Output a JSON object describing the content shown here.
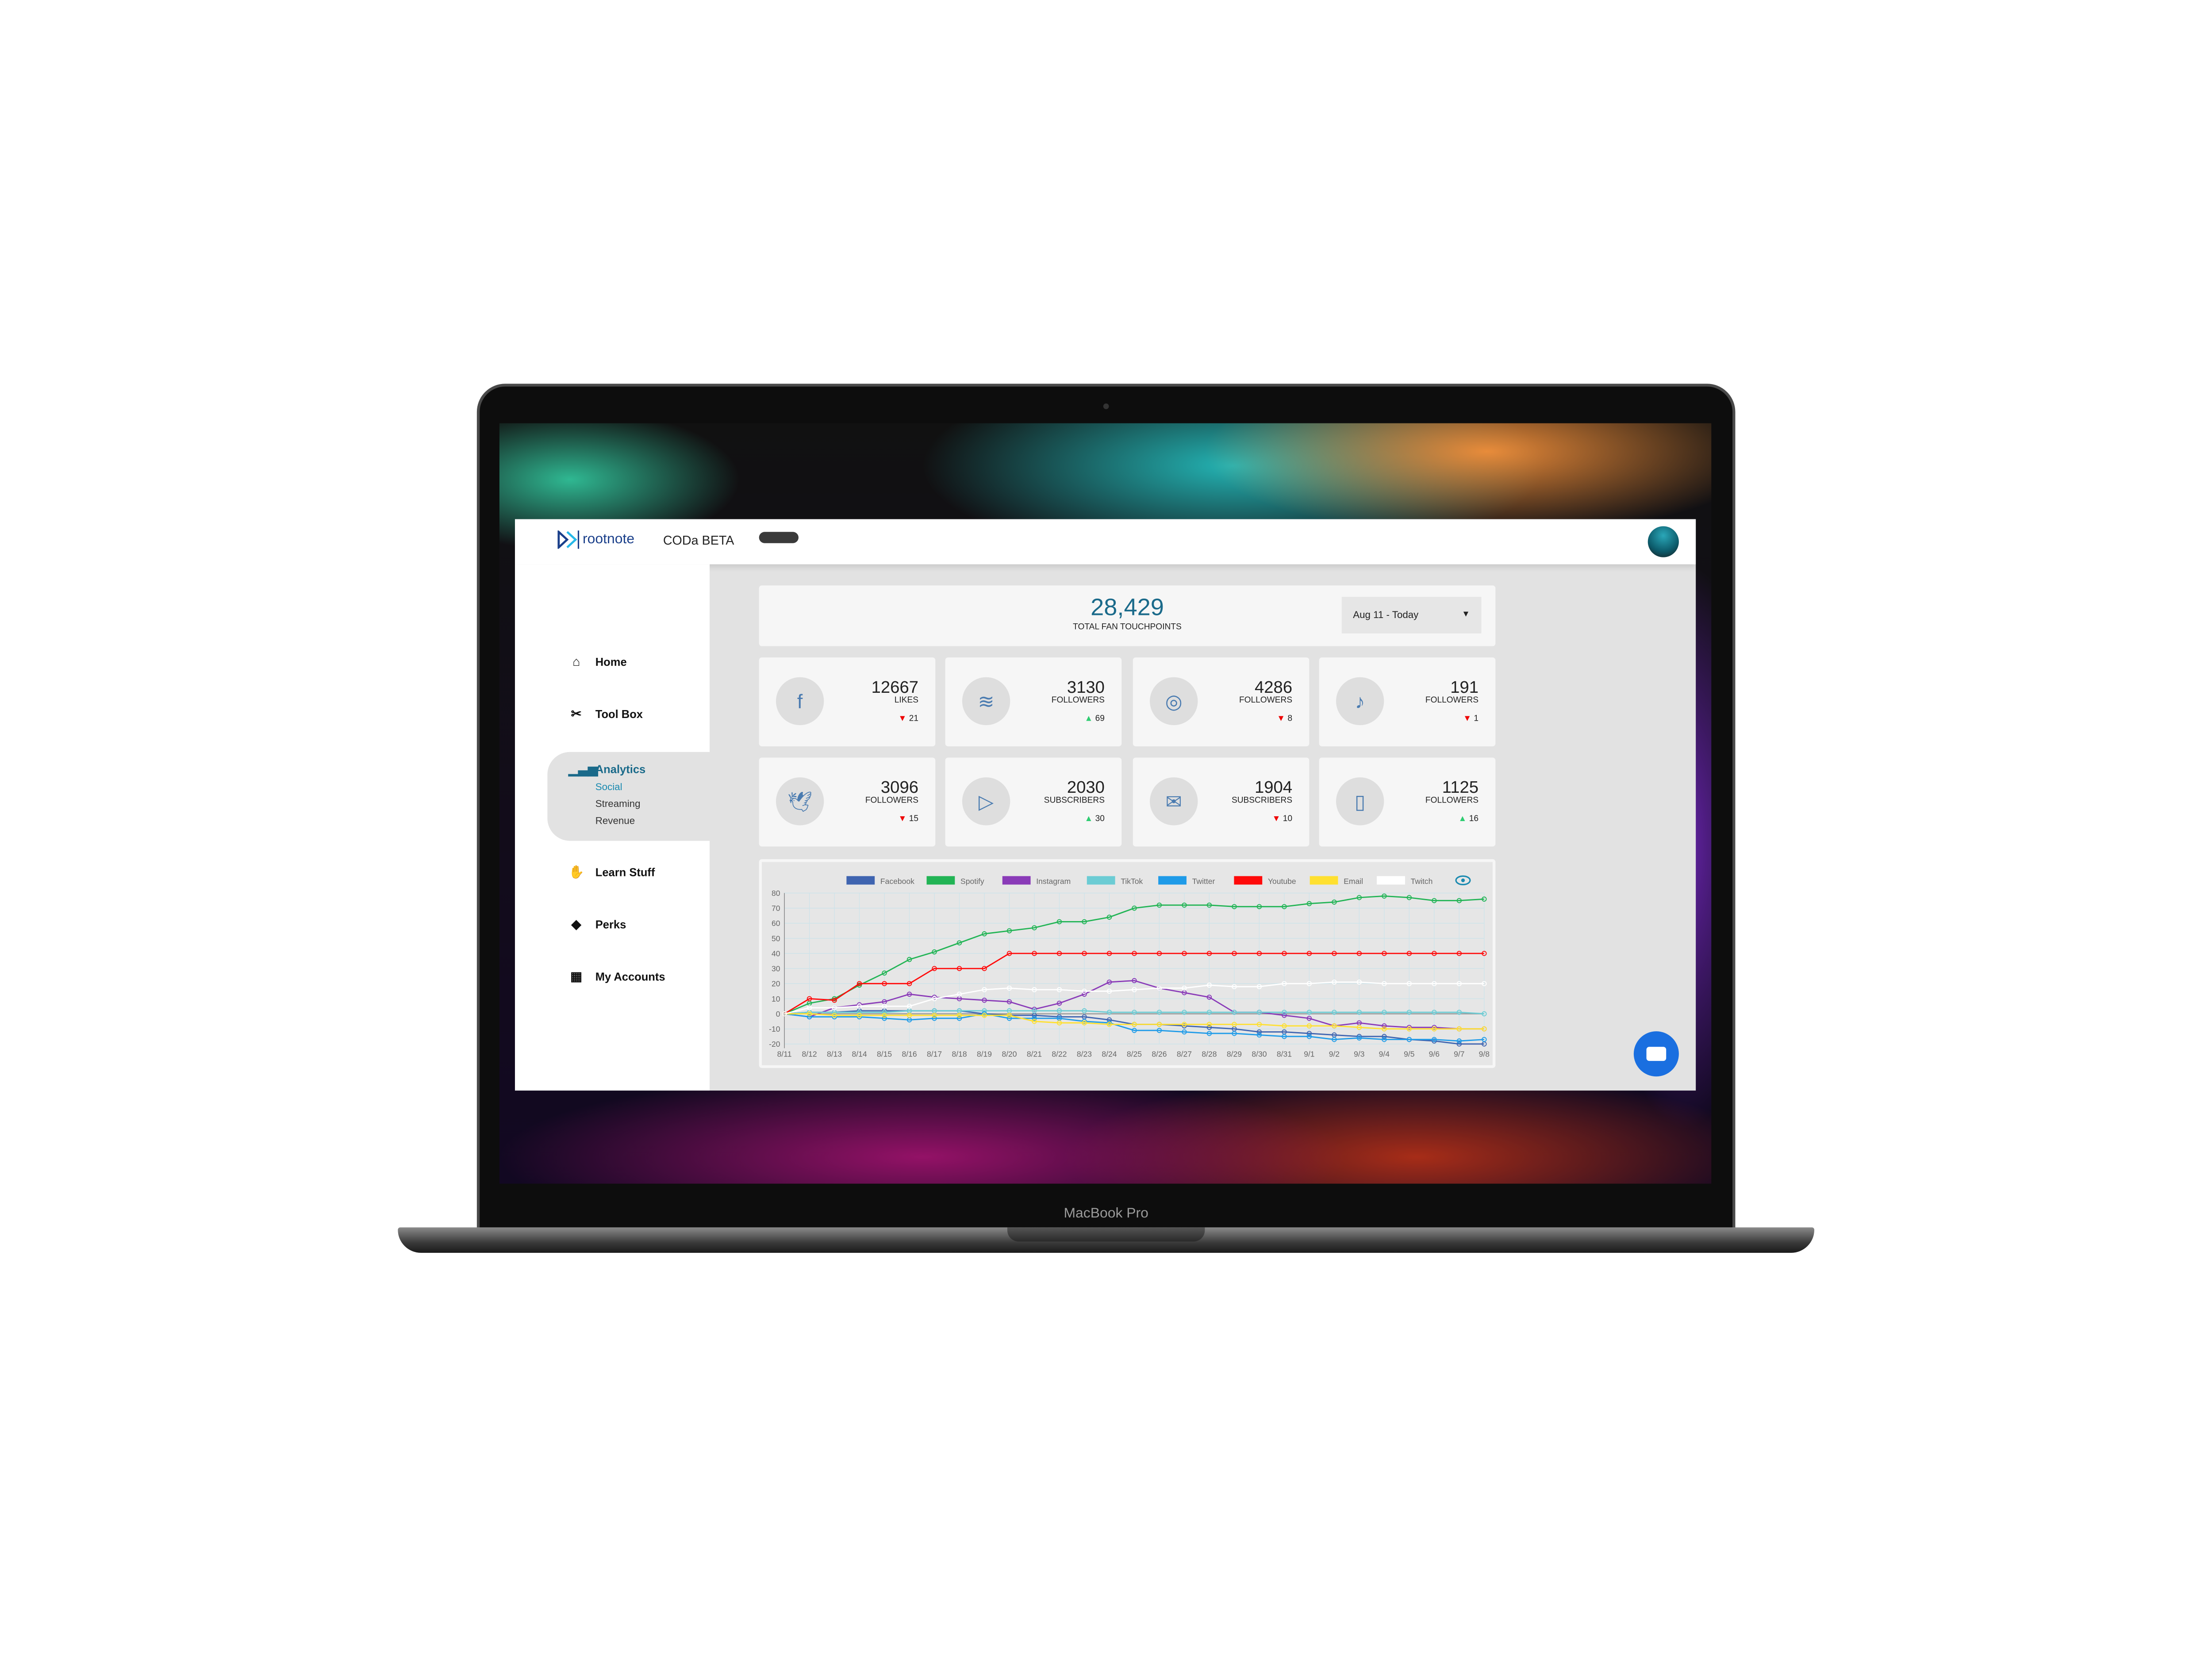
{
  "header": {
    "logo": "rootnote",
    "product": "CODa BETA"
  },
  "sidebar": {
    "items": [
      {
        "label": "Home",
        "icon": "home-icon"
      },
      {
        "label": "Tool Box",
        "icon": "tools-icon"
      },
      {
        "label": "Analytics",
        "icon": "bar-chart-icon",
        "active": true,
        "sub": [
          "Social",
          "Streaming",
          "Revenue"
        ],
        "active_sub": "Social"
      },
      {
        "label": "Learn Stuff",
        "icon": "hand-icon"
      },
      {
        "label": "Perks",
        "icon": "tag-icon"
      },
      {
        "label": "My Accounts",
        "icon": "grid-icon"
      }
    ]
  },
  "summary": {
    "value": "28,429",
    "label": "TOTAL FAN TOUCHPOINTS",
    "date_range": "Aug 11 - Today"
  },
  "stats": [
    {
      "platform": "Facebook",
      "icon": "facebook-icon",
      "value": "12667",
      "label": "LIKES",
      "change": "21",
      "dir": "down"
    },
    {
      "platform": "Spotify",
      "icon": "spotify-icon",
      "value": "3130",
      "label": "FOLLOWERS",
      "change": "69",
      "dir": "up"
    },
    {
      "platform": "Instagram",
      "icon": "instagram-icon",
      "value": "4286",
      "label": "FOLLOWERS",
      "change": "8",
      "dir": "down"
    },
    {
      "platform": "TikTok",
      "icon": "tiktok-icon",
      "value": "191",
      "label": "FOLLOWERS",
      "change": "1",
      "dir": "down"
    },
    {
      "platform": "Twitter",
      "icon": "twitter-icon",
      "value": "3096",
      "label": "FOLLOWERS",
      "change": "15",
      "dir": "down"
    },
    {
      "platform": "Youtube",
      "icon": "youtube-icon",
      "value": "2030",
      "label": "SUBSCRIBERS",
      "change": "30",
      "dir": "up"
    },
    {
      "platform": "Email",
      "icon": "mail-icon",
      "value": "1904",
      "label": "SUBSCRIBERS",
      "change": "10",
      "dir": "down"
    },
    {
      "platform": "Twitch",
      "icon": "twitch-icon",
      "value": "1125",
      "label": "FOLLOWERS",
      "change": "16",
      "dir": "up"
    }
  ],
  "device_label": "MacBook Pro",
  "chart_data": {
    "type": "line",
    "legend_position": "top",
    "grid": true,
    "ylim": [
      -20,
      80
    ],
    "yticks": [
      80,
      70,
      60,
      50,
      40,
      30,
      20,
      10,
      0,
      -10,
      -20
    ],
    "categories": [
      "8/11",
      "8/12",
      "8/13",
      "8/14",
      "8/15",
      "8/16",
      "8/17",
      "8/18",
      "8/19",
      "8/20",
      "8/21",
      "8/22",
      "8/23",
      "8/24",
      "8/25",
      "8/26",
      "8/27",
      "8/28",
      "8/29",
      "8/30",
      "8/31",
      "9/1",
      "9/2",
      "9/3",
      "9/4",
      "9/5",
      "9/6",
      "9/7",
      "9/8"
    ],
    "series": [
      {
        "name": "Facebook",
        "color": "#3f64b0",
        "values": [
          0,
          1,
          1,
          2,
          2,
          2,
          2,
          2,
          0,
          -1,
          -1,
          -2,
          -2,
          -4,
          -7,
          -7,
          -8,
          -9,
          -10,
          -12,
          -12,
          -13,
          -14,
          -15,
          -15,
          -17,
          -18,
          -20,
          -20
        ]
      },
      {
        "name": "Spotify",
        "color": "#22b455",
        "values": [
          0,
          7,
          10,
          19,
          27,
          36,
          41,
          47,
          53,
          55,
          57,
          61,
          61,
          64,
          70,
          72,
          72,
          72,
          71,
          71,
          71,
          73,
          74,
          77,
          78,
          77,
          75,
          75,
          76
        ]
      },
      {
        "name": "Instagram",
        "color": "#8a3bb8",
        "values": [
          0,
          -2,
          4,
          6,
          8,
          13,
          11,
          10,
          9,
          8,
          3,
          7,
          13,
          21,
          22,
          17,
          14,
          11,
          1,
          1,
          -1,
          -3,
          -8,
          -6,
          -8,
          -9,
          -9,
          -10,
          -10
        ]
      },
      {
        "name": "TikTok",
        "color": "#6cccd4",
        "values": [
          0,
          1,
          1,
          1,
          1,
          2,
          2,
          2,
          2,
          2,
          2,
          2,
          2,
          1,
          1,
          1,
          1,
          1,
          1,
          1,
          1,
          1,
          1,
          1,
          1,
          1,
          1,
          1,
          0
        ]
      },
      {
        "name": "Twitter",
        "color": "#1f9be8",
        "values": [
          0,
          -2,
          -2,
          -2,
          -3,
          -4,
          -3,
          -3,
          0,
          -3,
          -3,
          -3,
          -5,
          -6,
          -11,
          -11,
          -12,
          -13,
          -13,
          -14,
          -15,
          -15,
          -17,
          -16,
          -17,
          -17,
          -17,
          -18,
          -17
        ]
      },
      {
        "name": "Youtube",
        "color": "#ff0a0a",
        "values": [
          0,
          10,
          9,
          20,
          20,
          20,
          30,
          30,
          30,
          40,
          40,
          40,
          40,
          40,
          40,
          40,
          40,
          40,
          40,
          40,
          40,
          40,
          40,
          40,
          40,
          40,
          40,
          40,
          40
        ]
      },
      {
        "name": "Email",
        "color": "#ffe030",
        "values": [
          0,
          0,
          -1,
          -1,
          -1,
          -1,
          -1,
          -1,
          -1,
          -1,
          -5,
          -6,
          -6,
          -7,
          -7,
          -7,
          -7,
          -7,
          -7,
          -7,
          -8,
          -8,
          -8,
          -9,
          -10,
          -10,
          -10,
          -10,
          -10
        ]
      },
      {
        "name": "Twitch",
        "color": "#ffffff",
        "values": [
          0,
          4,
          4,
          5,
          5,
          5,
          10,
          13,
          16,
          17,
          16,
          16,
          15,
          15,
          16,
          17,
          17,
          19,
          18,
          18,
          20,
          20,
          21,
          21,
          20,
          20,
          20,
          20,
          20
        ]
      }
    ]
  }
}
